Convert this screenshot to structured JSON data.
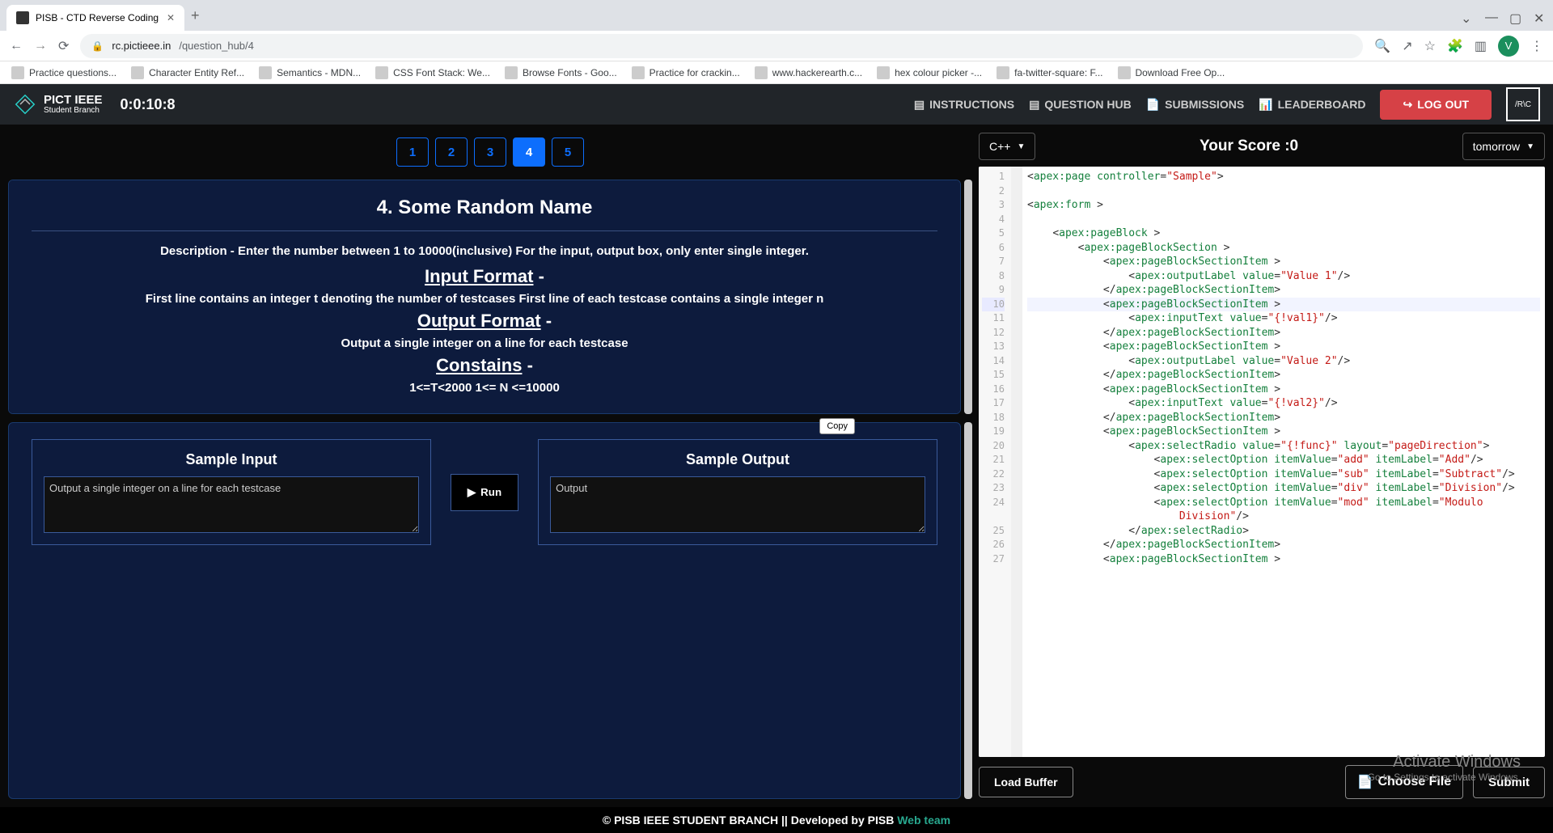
{
  "browser": {
    "tab_title": "PISB - CTD Reverse Coding",
    "url_host": "rc.pictieee.in",
    "url_path": "/question_hub/4",
    "profile_letter": "V",
    "bookmarks": [
      "Practice questions...",
      "Character Entity Ref...",
      "Semantics - MDN...",
      "CSS Font Stack: We...",
      "Browse Fonts - Goo...",
      "Practice for crackin...",
      "www.hackerearth.c...",
      "hex colour picker -...",
      "fa-twitter-square: F...",
      "Download Free Op..."
    ]
  },
  "header": {
    "brand_top": "PICT IEEE",
    "brand_sub": "Student Branch",
    "timer": "0:0:10:8",
    "nav": {
      "instructions": "INSTRUCTIONS",
      "question_hub": "QUESTION HUB",
      "submissions": "SUBMISSIONS",
      "leaderboard": "LEADERBOARD"
    },
    "logout": "LOG OUT",
    "rc_badge": "/R\\C"
  },
  "question_tabs": [
    "1",
    "2",
    "3",
    "4",
    "5"
  ],
  "active_tab": "4",
  "question": {
    "title": "4. Some Random Name",
    "description": "Description - Enter the number between 1 to 10000(inclusive) For the input, output box, only enter single integer.",
    "input_format_h": "Input Format",
    "input_format": "First line contains an integer t denoting the number of testcases First line of each testcase contains a single integer n",
    "output_format_h": "Output Format",
    "output_format": "Output a single integer on a line for each testcase",
    "constraints_h": "Constains",
    "constraints": "1<=T<2000 1<= N <=10000"
  },
  "io": {
    "sample_input_h": "Sample Input",
    "sample_input_val": "Output a single integer on a line for each testcase",
    "sample_output_h": "Sample Output",
    "sample_output_val": "Output",
    "run": "Run",
    "copy": "Copy"
  },
  "editor_top": {
    "language": "C++",
    "score_label": "Your Score :",
    "score_value": "0",
    "theme": "tomorrow"
  },
  "code_lines": [
    {
      "n": 1,
      "ind": 0,
      "tokens": [
        {
          "t": "punc",
          "v": "<"
        },
        {
          "t": "tag",
          "v": "apex:page"
        },
        {
          "t": "txt",
          "v": " "
        },
        {
          "t": "tag",
          "v": "controller"
        },
        {
          "t": "punc",
          "v": "="
        },
        {
          "t": "str",
          "v": "\"Sample\""
        },
        {
          "t": "punc",
          "v": ">"
        }
      ]
    },
    {
      "n": 2,
      "ind": 0,
      "tokens": []
    },
    {
      "n": 3,
      "ind": 0,
      "tokens": [
        {
          "t": "punc",
          "v": "<"
        },
        {
          "t": "tag",
          "v": "apex:form"
        },
        {
          "t": "txt",
          "v": " "
        },
        {
          "t": "punc",
          "v": ">"
        }
      ]
    },
    {
      "n": 4,
      "ind": 0,
      "tokens": []
    },
    {
      "n": 5,
      "ind": 1,
      "tokens": [
        {
          "t": "punc",
          "v": "<"
        },
        {
          "t": "tag",
          "v": "apex:pageBlock"
        },
        {
          "t": "txt",
          "v": " "
        },
        {
          "t": "punc",
          "v": ">"
        }
      ]
    },
    {
      "n": 6,
      "ind": 2,
      "tokens": [
        {
          "t": "punc",
          "v": "<"
        },
        {
          "t": "tag",
          "v": "apex:pageBlockSection"
        },
        {
          "t": "txt",
          "v": " "
        },
        {
          "t": "punc",
          "v": ">"
        }
      ]
    },
    {
      "n": 7,
      "ind": 3,
      "tokens": [
        {
          "t": "punc",
          "v": "<"
        },
        {
          "t": "tag",
          "v": "apex:pageBlockSectionItem"
        },
        {
          "t": "txt",
          "v": " "
        },
        {
          "t": "punc",
          "v": ">"
        }
      ]
    },
    {
      "n": 8,
      "ind": 4,
      "tokens": [
        {
          "t": "punc",
          "v": "<"
        },
        {
          "t": "tag",
          "v": "apex:outputLabel"
        },
        {
          "t": "txt",
          "v": " "
        },
        {
          "t": "tag",
          "v": "value"
        },
        {
          "t": "punc",
          "v": "="
        },
        {
          "t": "str",
          "v": "\"Value 1\""
        },
        {
          "t": "punc",
          "v": "/>"
        }
      ]
    },
    {
      "n": 9,
      "ind": 3,
      "tokens": [
        {
          "t": "punc",
          "v": "</"
        },
        {
          "t": "tag",
          "v": "apex:pageBlockSectionItem"
        },
        {
          "t": "punc",
          "v": ">"
        }
      ]
    },
    {
      "n": 10,
      "ind": 3,
      "hl": true,
      "tokens": [
        {
          "t": "punc",
          "v": "<"
        },
        {
          "t": "tag",
          "v": "apex:pageBlockSectionItem"
        },
        {
          "t": "txt",
          "v": " "
        },
        {
          "t": "punc",
          "v": ">"
        }
      ]
    },
    {
      "n": 11,
      "ind": 4,
      "tokens": [
        {
          "t": "punc",
          "v": "<"
        },
        {
          "t": "tag",
          "v": "apex:inputText"
        },
        {
          "t": "txt",
          "v": " "
        },
        {
          "t": "tag",
          "v": "value"
        },
        {
          "t": "punc",
          "v": "="
        },
        {
          "t": "str",
          "v": "\"{!val1}\""
        },
        {
          "t": "punc",
          "v": "/>"
        }
      ]
    },
    {
      "n": 12,
      "ind": 3,
      "tokens": [
        {
          "t": "punc",
          "v": "</"
        },
        {
          "t": "tag",
          "v": "apex:pageBlockSectionItem"
        },
        {
          "t": "punc",
          "v": ">"
        }
      ]
    },
    {
      "n": 13,
      "ind": 3,
      "tokens": [
        {
          "t": "punc",
          "v": "<"
        },
        {
          "t": "tag",
          "v": "apex:pageBlockSectionItem"
        },
        {
          "t": "txt",
          "v": " "
        },
        {
          "t": "punc",
          "v": ">"
        }
      ]
    },
    {
      "n": 14,
      "ind": 4,
      "tokens": [
        {
          "t": "punc",
          "v": "<"
        },
        {
          "t": "tag",
          "v": "apex:outputLabel"
        },
        {
          "t": "txt",
          "v": " "
        },
        {
          "t": "tag",
          "v": "value"
        },
        {
          "t": "punc",
          "v": "="
        },
        {
          "t": "str",
          "v": "\"Value 2\""
        },
        {
          "t": "punc",
          "v": "/>"
        }
      ]
    },
    {
      "n": 15,
      "ind": 3,
      "tokens": [
        {
          "t": "punc",
          "v": "</"
        },
        {
          "t": "tag",
          "v": "apex:pageBlockSectionItem"
        },
        {
          "t": "punc",
          "v": ">"
        }
      ]
    },
    {
      "n": 16,
      "ind": 3,
      "tokens": [
        {
          "t": "punc",
          "v": "<"
        },
        {
          "t": "tag",
          "v": "apex:pageBlockSectionItem"
        },
        {
          "t": "txt",
          "v": " "
        },
        {
          "t": "punc",
          "v": ">"
        }
      ]
    },
    {
      "n": 17,
      "ind": 4,
      "tokens": [
        {
          "t": "punc",
          "v": "<"
        },
        {
          "t": "tag",
          "v": "apex:inputText"
        },
        {
          "t": "txt",
          "v": " "
        },
        {
          "t": "tag",
          "v": "value"
        },
        {
          "t": "punc",
          "v": "="
        },
        {
          "t": "str",
          "v": "\"{!val2}\""
        },
        {
          "t": "punc",
          "v": "/>"
        }
      ]
    },
    {
      "n": 18,
      "ind": 3,
      "tokens": [
        {
          "t": "punc",
          "v": "</"
        },
        {
          "t": "tag",
          "v": "apex:pageBlockSectionItem"
        },
        {
          "t": "punc",
          "v": ">"
        }
      ]
    },
    {
      "n": 19,
      "ind": 3,
      "tokens": [
        {
          "t": "punc",
          "v": "<"
        },
        {
          "t": "tag",
          "v": "apex:pageBlockSectionItem"
        },
        {
          "t": "txt",
          "v": " "
        },
        {
          "t": "punc",
          "v": ">"
        }
      ]
    },
    {
      "n": 20,
      "ind": 4,
      "tokens": [
        {
          "t": "punc",
          "v": "<"
        },
        {
          "t": "tag",
          "v": "apex:selectRadio"
        },
        {
          "t": "txt",
          "v": " "
        },
        {
          "t": "tag",
          "v": "value"
        },
        {
          "t": "punc",
          "v": "="
        },
        {
          "t": "str",
          "v": "\"{!func}\""
        },
        {
          "t": "txt",
          "v": " "
        },
        {
          "t": "tag",
          "v": "layout"
        },
        {
          "t": "punc",
          "v": "="
        },
        {
          "t": "str",
          "v": "\"pageDirection\""
        },
        {
          "t": "punc",
          "v": ">"
        }
      ]
    },
    {
      "n": 21,
      "ind": 5,
      "tokens": [
        {
          "t": "punc",
          "v": "<"
        },
        {
          "t": "tag",
          "v": "apex:selectOption"
        },
        {
          "t": "txt",
          "v": " "
        },
        {
          "t": "tag",
          "v": "itemValue"
        },
        {
          "t": "punc",
          "v": "="
        },
        {
          "t": "str",
          "v": "\"add\""
        },
        {
          "t": "txt",
          "v": " "
        },
        {
          "t": "tag",
          "v": "itemLabel"
        },
        {
          "t": "punc",
          "v": "="
        },
        {
          "t": "str",
          "v": "\"Add\""
        },
        {
          "t": "punc",
          "v": "/>"
        }
      ]
    },
    {
      "n": 22,
      "ind": 5,
      "tokens": [
        {
          "t": "punc",
          "v": "<"
        },
        {
          "t": "tag",
          "v": "apex:selectOption"
        },
        {
          "t": "txt",
          "v": " "
        },
        {
          "t": "tag",
          "v": "itemValue"
        },
        {
          "t": "punc",
          "v": "="
        },
        {
          "t": "str",
          "v": "\"sub\""
        },
        {
          "t": "txt",
          "v": " "
        },
        {
          "t": "tag",
          "v": "itemLabel"
        },
        {
          "t": "punc",
          "v": "="
        },
        {
          "t": "str",
          "v": "\"Subtract\""
        },
        {
          "t": "punc",
          "v": "/>"
        }
      ]
    },
    {
      "n": 23,
      "ind": 5,
      "tokens": [
        {
          "t": "punc",
          "v": "<"
        },
        {
          "t": "tag",
          "v": "apex:selectOption"
        },
        {
          "t": "txt",
          "v": " "
        },
        {
          "t": "tag",
          "v": "itemValue"
        },
        {
          "t": "punc",
          "v": "="
        },
        {
          "t": "str",
          "v": "\"div\""
        },
        {
          "t": "txt",
          "v": " "
        },
        {
          "t": "tag",
          "v": "itemLabel"
        },
        {
          "t": "punc",
          "v": "="
        },
        {
          "t": "str",
          "v": "\"Division\""
        },
        {
          "t": "punc",
          "v": "/>"
        }
      ]
    },
    {
      "n": 24,
      "ind": 5,
      "tokens": [
        {
          "t": "punc",
          "v": "<"
        },
        {
          "t": "tag",
          "v": "apex:selectOption"
        },
        {
          "t": "txt",
          "v": " "
        },
        {
          "t": "tag",
          "v": "itemValue"
        },
        {
          "t": "punc",
          "v": "="
        },
        {
          "t": "str",
          "v": "\"mod\""
        },
        {
          "t": "txt",
          "v": " "
        },
        {
          "t": "tag",
          "v": "itemLabel"
        },
        {
          "t": "punc",
          "v": "="
        },
        {
          "t": "str",
          "v": "\"Modulo "
        }
      ]
    },
    {
      "n": "",
      "ind": 6,
      "tokens": [
        {
          "t": "str",
          "v": "Division\""
        },
        {
          "t": "punc",
          "v": "/>"
        }
      ]
    },
    {
      "n": 25,
      "ind": 4,
      "tokens": [
        {
          "t": "punc",
          "v": "</"
        },
        {
          "t": "tag",
          "v": "apex:selectRadio"
        },
        {
          "t": "punc",
          "v": ">"
        }
      ]
    },
    {
      "n": 26,
      "ind": 3,
      "tokens": [
        {
          "t": "punc",
          "v": "</"
        },
        {
          "t": "tag",
          "v": "apex:pageBlockSectionItem"
        },
        {
          "t": "punc",
          "v": ">"
        }
      ]
    },
    {
      "n": 27,
      "ind": 3,
      "tokens": [
        {
          "t": "punc",
          "v": "<"
        },
        {
          "t": "tag",
          "v": "apex:pageBlockSectionItem"
        },
        {
          "t": "txt",
          "v": " "
        },
        {
          "t": "punc",
          "v": ">"
        }
      ]
    }
  ],
  "bottom": {
    "load_buffer": "Load Buffer",
    "choose_file": "Choose File",
    "submit": "Submit"
  },
  "watermark": {
    "title": "Activate Windows",
    "sub": "Go to Settings to activate Windows."
  },
  "footer": {
    "prefix": "© PISB IEEE STUDENT BRANCH || Developed by PISB ",
    "link": "Web team"
  }
}
